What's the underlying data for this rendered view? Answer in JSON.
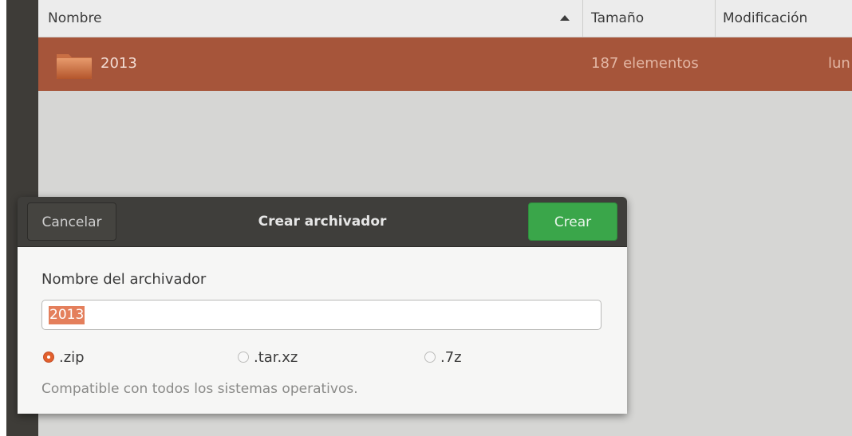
{
  "file_list": {
    "columns": {
      "name": "Nombre",
      "size": "Tamaño",
      "modified": "Modificación"
    },
    "rows": [
      {
        "name": "2013",
        "size": "187 elementos",
        "modified": "lun",
        "icon": "folder-icon"
      }
    ]
  },
  "dialog": {
    "title": "Crear archivador",
    "cancel_label": "Cancelar",
    "create_label": "Crear",
    "field_label": "Nombre del archivador",
    "field_value": "2013",
    "formats": [
      {
        "label": ".zip",
        "selected": true
      },
      {
        "label": ".tar.xz",
        "selected": false
      },
      {
        "label": ".7z",
        "selected": false
      }
    ],
    "hint": "Compatible con todos los sistemas operativos."
  },
  "colors": {
    "selection_row": "#a6553a",
    "create_button": "#3aa64a",
    "radio_selected": "#e2602d",
    "text_selection": "#e47f5c"
  }
}
